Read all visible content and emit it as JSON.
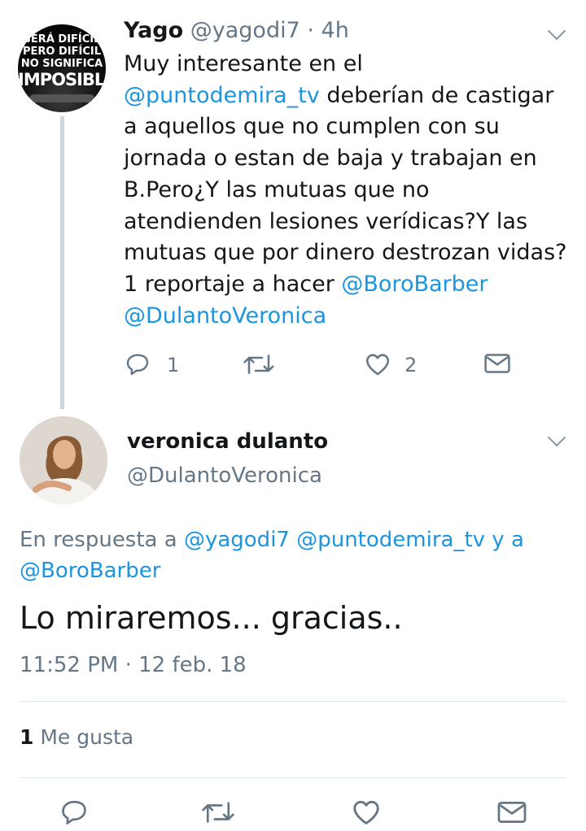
{
  "tweet1": {
    "name": "Yago",
    "handle": "@yagodi7",
    "time": "· 4h",
    "avatar_text": [
      "SERÁ DIFÍCIL",
      "PERO DIFÍCIL",
      "NO SIGNIFICA",
      "IMPOSIBLE."
    ],
    "body": {
      "l1": "Muy interesante en el",
      "l2_mention": "@puntodemira_tv",
      "l2_text": " deberían de castigar",
      "l3": "a aquellos que no cumplen con su",
      "l4": "jornada o estan de baja y trabajan en",
      "l5": "B.Pero¿Y las mutuas que no",
      "l6": "atendienden lesiones verídicas?Y las",
      "l7": "mutuas que por dinero destrozan vidas?",
      "l8_text": "1 reportaje a hacer ",
      "l8_mention": "@BoroBarber",
      "l9_mention": "@DulantoVeronica"
    },
    "reply_count": "1",
    "like_count": "2"
  },
  "tweet2": {
    "name": "veronica dulanto",
    "handle": "@DulantoVeronica",
    "reply_prefix": "En respuesta a ",
    "reply_m1": "@yagodi7",
    "reply_m2": "@puntodemira_tv",
    "reply_and": " y a",
    "reply_m3": "@BoroBarber",
    "text": "Lo miraremos... gracias..",
    "timestamp": "11:52 PM · 12 feb. 18",
    "likes_count": "1",
    "likes_label": " Me gusta"
  },
  "colors": {
    "link": "#1b95e0",
    "muted": "#657786",
    "text": "#14171a",
    "icon": "#657786",
    "divider": "#e1e8ed"
  },
  "icons": [
    "reply-icon",
    "retweet-icon",
    "like-icon",
    "dm-icon",
    "chevron-down-icon"
  ]
}
